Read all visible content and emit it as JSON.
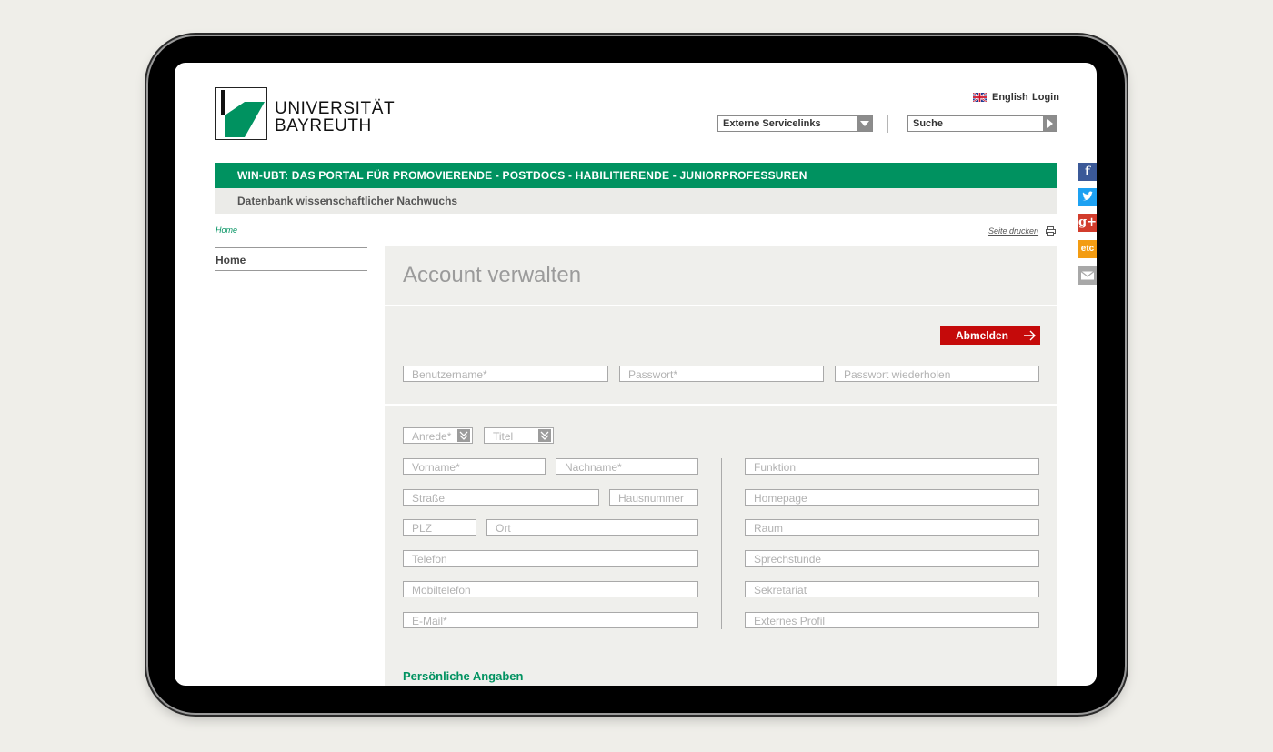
{
  "header": {
    "logo_line1": "UNIVERSITÄT",
    "logo_line2": "BAYREUTH",
    "lang_label": "English",
    "login_label": "Login",
    "servicelinks_value": "Externe Servicelinks",
    "search_placeholder": "Suche"
  },
  "portal_bar": {
    "title": "WIN-UBT: DAS PORTAL FÜR PROMOVIERENDE - POSTDOCS - HABILITIERENDE - JUNIORPROFESSUREN",
    "subtitle": "Datenbank wissenschaftlicher Nachwuchs"
  },
  "breadcrumb": {
    "home": "Home"
  },
  "print_label": "Seite drucken",
  "sidebar": {
    "items": [
      {
        "label": "Home"
      }
    ]
  },
  "main": {
    "title": "Account verwalten",
    "logout_label": "Abmelden",
    "account_fields": {
      "username": "Benutzername*",
      "password": "Passwort*",
      "password_repeat": "Passwort wiederholen"
    },
    "selects": {
      "salutation": "Anrede*",
      "title": "Titel"
    },
    "left_fields": {
      "first_name": "Vorname*",
      "last_name": "Nachname*",
      "street": "Straße",
      "house_number": "Hausnummer",
      "zip": "PLZ",
      "city": "Ort",
      "phone": "Telefon",
      "mobile": "Mobiltelefon",
      "email": "E-Mail*"
    },
    "right_fields": {
      "function": "Funktion",
      "homepage": "Homepage",
      "room": "Raum",
      "office_hours": "Sprechstunde",
      "secretariat": "Sekretariat",
      "external_profile": "Externes Profil"
    },
    "section_personal": "Persönliche Angaben"
  },
  "social": {
    "facebook": "f",
    "google_plus": "g+",
    "etc": "etc"
  },
  "colors": {
    "brand_green": "#009260",
    "logout_red": "#c50a0a",
    "facebook": "#3b5998",
    "twitter": "#1da1f2",
    "google_plus": "#d23c2c",
    "etc": "#f39c12",
    "mail": "#a8a8a8"
  }
}
